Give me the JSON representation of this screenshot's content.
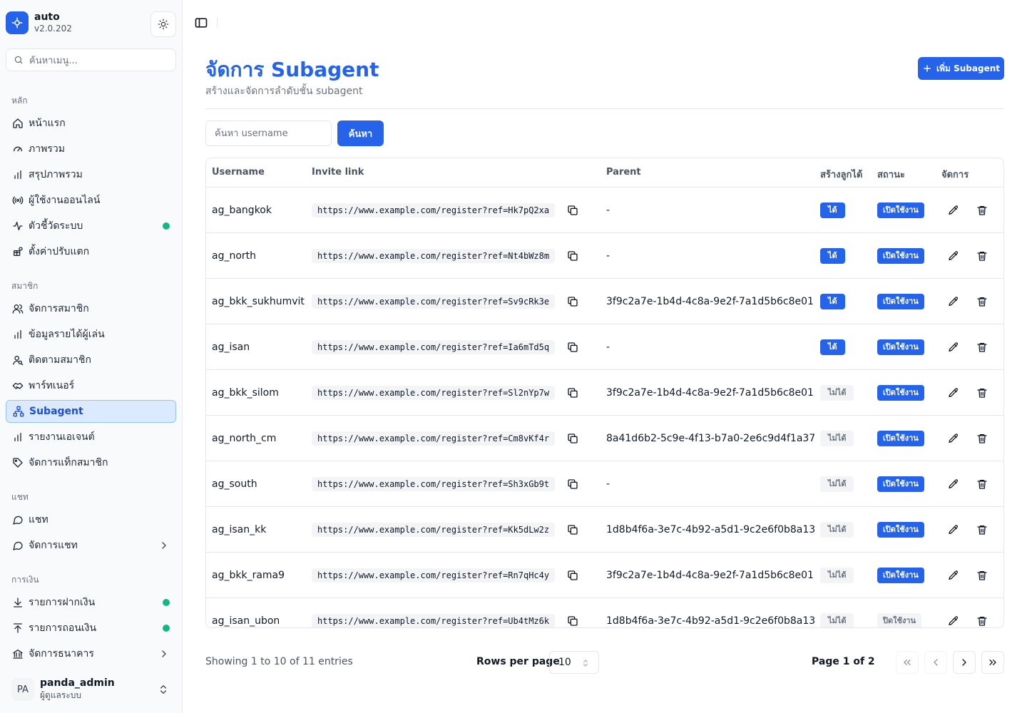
{
  "brand": {
    "name": "auto",
    "version": "v2.0.202"
  },
  "sidebar": {
    "search_placeholder": "ค้นหาเมนู...",
    "sections": [
      {
        "label": "หลัก",
        "items": [
          {
            "label": "หน้าแรก",
            "icon": "home-icon"
          },
          {
            "label": "ภาพรวม",
            "icon": "gauge-icon"
          },
          {
            "label": "สรุปภาพรวม",
            "icon": "bar-chart-icon"
          },
          {
            "label": "ผู้ใช้งานออนไลน์",
            "icon": "broadcast-icon"
          },
          {
            "label": "ตัวชี้วัดระบบ",
            "icon": "activity-icon",
            "dot": true
          },
          {
            "label": "ตั้งค่าปรับแตก",
            "icon": "gift-settings-icon"
          }
        ]
      },
      {
        "label": "สมาชิก",
        "items": [
          {
            "label": "จัดการสมาชิก",
            "icon": "users-icon"
          },
          {
            "label": "ข้อมูลรายได้ผู้เล่น",
            "icon": "bar-chart-icon"
          },
          {
            "label": "ติดตามสมาชิก",
            "icon": "user-search-icon"
          },
          {
            "label": "พาร์ทเนอร์",
            "icon": "handshake-icon"
          },
          {
            "label": "Subagent",
            "icon": "network-icon",
            "active": true
          },
          {
            "label": "รายงานเอเจนต์",
            "icon": "bar-chart-icon"
          },
          {
            "label": "จัดการแท็กสมาชิก",
            "icon": "tag-icon"
          }
        ]
      },
      {
        "label": "แชท",
        "items": [
          {
            "label": "แชท",
            "icon": "chat-icon"
          },
          {
            "label": "จัดการแชท",
            "icon": "chat-icon",
            "chevron": true
          }
        ]
      },
      {
        "label": "การเงิน",
        "items": [
          {
            "label": "รายการฝากเงิน",
            "icon": "download-icon",
            "dot": true
          },
          {
            "label": "รายการถอนเงิน",
            "icon": "upload-icon",
            "dot": true
          },
          {
            "label": "จัดการธนาคาร",
            "icon": "bank-icon",
            "chevron": true
          }
        ]
      }
    ]
  },
  "user": {
    "initials": "PA",
    "name": "panda_admin",
    "role": "ผู้ดูแลระบบ"
  },
  "page": {
    "title": "จัดการ Subagent",
    "subtitle": "สร้างและจัดการลำดับชั้น subagent",
    "add_button": "เพิ่ม Subagent",
    "search_placeholder": "ค้นหา username",
    "search_button": "ค้นหา"
  },
  "table": {
    "headers": [
      "Username",
      "Invite link",
      "Parent",
      "สร้างลูกได้",
      "สถานะ",
      "จัดการ"
    ],
    "rows": [
      {
        "username": "ag_bangkok",
        "link": "https://www.example.com/register?ref=Hk7pQ2xa",
        "parent": "-",
        "can_create": "ได้",
        "can": true,
        "status": "เปิดใช้งาน",
        "active": true
      },
      {
        "username": "ag_north",
        "link": "https://www.example.com/register?ref=Nt4bWz8m",
        "parent": "-",
        "can_create": "ได้",
        "can": true,
        "status": "เปิดใช้งาน",
        "active": true
      },
      {
        "username": "ag_bkk_sukhumvit",
        "link": "https://www.example.com/register?ref=Sv9cRk3e",
        "parent": "3f9c2a7e-1b4d-4c8a-9e2f-7a1d5b6c8e01",
        "can_create": "ได้",
        "can": true,
        "status": "เปิดใช้งาน",
        "active": true
      },
      {
        "username": "ag_isan",
        "link": "https://www.example.com/register?ref=Ia6mTd5q",
        "parent": "-",
        "can_create": "ได้",
        "can": true,
        "status": "เปิดใช้งาน",
        "active": true
      },
      {
        "username": "ag_bkk_silom",
        "link": "https://www.example.com/register?ref=Sl2nYp7w",
        "parent": "3f9c2a7e-1b4d-4c8a-9e2f-7a1d5b6c8e01",
        "can_create": "ไม่ได้",
        "can": false,
        "status": "เปิดใช้งาน",
        "active": true
      },
      {
        "username": "ag_north_cm",
        "link": "https://www.example.com/register?ref=Cm8vKf4r",
        "parent": "8a41d6b2-5c9e-4f13-b7a0-2e6c9d4f1a37",
        "can_create": "ไม่ได้",
        "can": false,
        "status": "เปิดใช้งาน",
        "active": true
      },
      {
        "username": "ag_south",
        "link": "https://www.example.com/register?ref=Sh3xGb9t",
        "parent": "-",
        "can_create": "ไม่ได้",
        "can": false,
        "status": "เปิดใช้งาน",
        "active": true
      },
      {
        "username": "ag_isan_kk",
        "link": "https://www.example.com/register?ref=Kk5dLw2z",
        "parent": "1d8b4f6a-3e7c-4b92-a5d1-9c2e6f0b8a13",
        "can_create": "ไม่ได้",
        "can": false,
        "status": "เปิดใช้งาน",
        "active": true
      },
      {
        "username": "ag_bkk_rama9",
        "link": "https://www.example.com/register?ref=Rn7qHc4y",
        "parent": "3f9c2a7e-1b4d-4c8a-9e2f-7a1d5b6c8e01",
        "can_create": "ไม่ได้",
        "can": false,
        "status": "เปิดใช้งาน",
        "active": true
      },
      {
        "username": "ag_isan_ubon",
        "link": "https://www.example.com/register?ref=Ub4tMz6k",
        "parent": "1d8b4f6a-3e7c-4b92-a5d1-9c2e6f0b8a13",
        "can_create": "ไม่ได้",
        "can": false,
        "status": "ปิดใช้งาน",
        "active": false
      }
    ]
  },
  "pagination": {
    "showing": "Showing 1 to 10 of 11 entries",
    "rows_per_page_label": "Rows per page",
    "rows_per_page": "10",
    "page_label": "Page 1 of 2"
  },
  "colors": {
    "accent": "#2563eb",
    "online_dot": "#10b981"
  }
}
